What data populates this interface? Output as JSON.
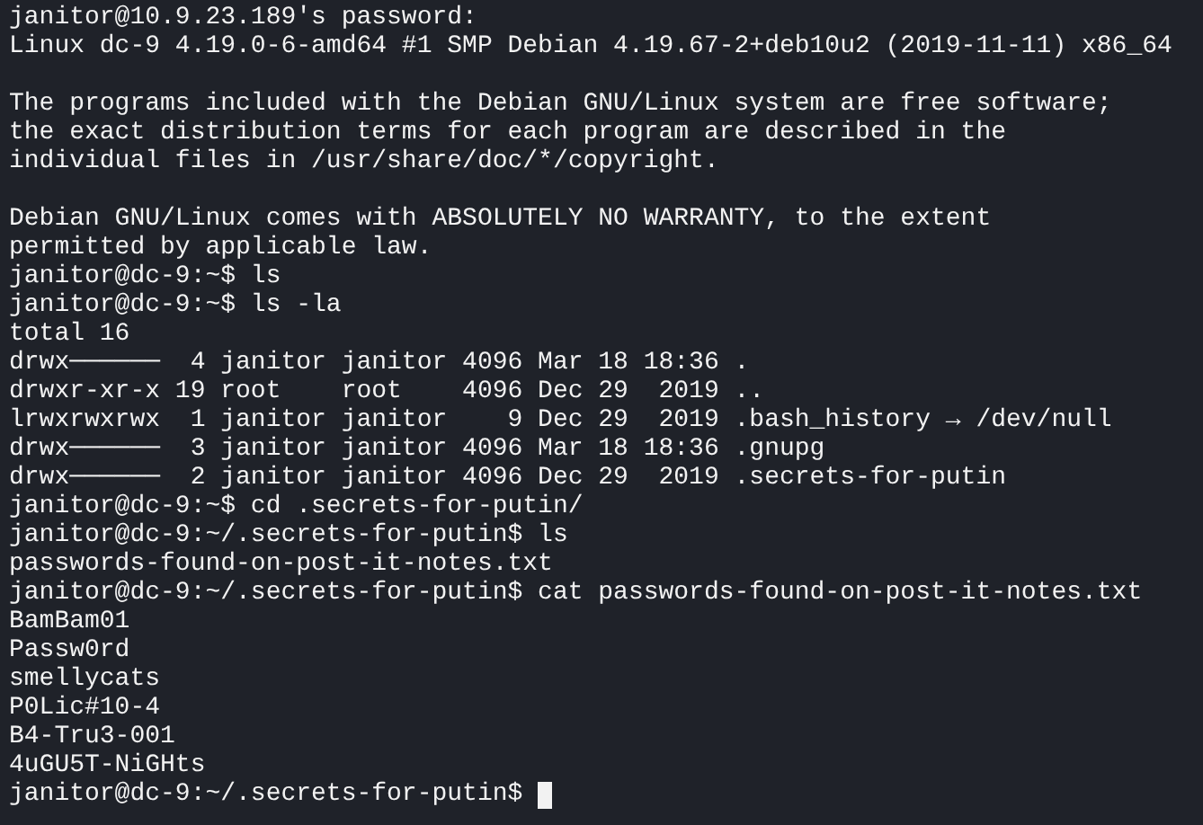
{
  "terminal": {
    "lines": [
      {
        "kind": "output",
        "text": "janitor@10.9.23.189's password:"
      },
      {
        "kind": "output",
        "text": "Linux dc-9 4.19.0-6-amd64 #1 SMP Debian 4.19.67-2+deb10u2 (2019-11-11) x86_64"
      },
      {
        "kind": "blank"
      },
      {
        "kind": "output",
        "text": "The programs included with the Debian GNU/Linux system are free software;"
      },
      {
        "kind": "output",
        "text": "the exact distribution terms for each program are described in the"
      },
      {
        "kind": "output",
        "text": "individual files in /usr/share/doc/*/copyright."
      },
      {
        "kind": "blank"
      },
      {
        "kind": "output",
        "text": "Debian GNU/Linux comes with ABSOLUTELY NO WARRANTY, to the extent"
      },
      {
        "kind": "output",
        "text": "permitted by applicable law."
      },
      {
        "kind": "command",
        "text": "janitor@dc-9:~$ ls"
      },
      {
        "kind": "command",
        "text": "janitor@dc-9:~$ ls -la"
      },
      {
        "kind": "output",
        "text": "total 16"
      },
      {
        "kind": "output",
        "text": "drwx──────  4 janitor janitor 4096 Mar 18 18:36 ."
      },
      {
        "kind": "output",
        "text": "drwxr-xr-x 19 root    root    4096 Dec 29  2019 .."
      },
      {
        "kind": "output",
        "text": "lrwxrwxrwx  1 janitor janitor    9 Dec 29  2019 .bash_history → /dev/null"
      },
      {
        "kind": "output",
        "text": "drwx──────  3 janitor janitor 4096 Mar 18 18:36 .gnupg"
      },
      {
        "kind": "output",
        "text": "drwx──────  2 janitor janitor 4096 Dec 29  2019 .secrets-for-putin"
      },
      {
        "kind": "command",
        "text": "janitor@dc-9:~$ cd .secrets-for-putin/"
      },
      {
        "kind": "command",
        "text": "janitor@dc-9:~/.secrets-for-putin$ ls"
      },
      {
        "kind": "output",
        "text": "passwords-found-on-post-it-notes.txt"
      },
      {
        "kind": "command",
        "text": "janitor@dc-9:~/.secrets-for-putin$ cat passwords-found-on-post-it-notes.txt"
      },
      {
        "kind": "output",
        "text": "BamBam01"
      },
      {
        "kind": "output",
        "text": "Passw0rd"
      },
      {
        "kind": "output",
        "text": "smellycats"
      },
      {
        "kind": "output",
        "text": "P0Lic#10-4"
      },
      {
        "kind": "output",
        "text": "B4-Tru3-001"
      },
      {
        "kind": "output",
        "text": "4uGU5T-NiGHts"
      }
    ],
    "prompt": {
      "text": "janitor@dc-9:~/.secrets-for-putin$",
      "cursor": true
    }
  }
}
